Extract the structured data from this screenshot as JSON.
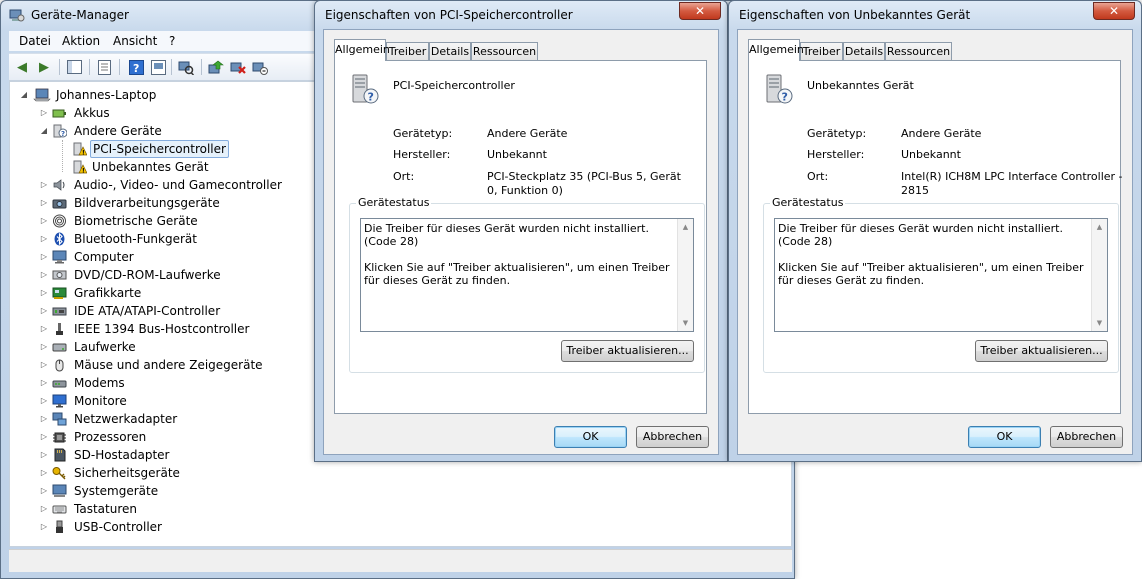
{
  "device_manager": {
    "title": "Geräte-Manager",
    "menu": [
      "Datei",
      "Aktion",
      "Ansicht",
      "?"
    ],
    "toolbar_icons": [
      "back-icon",
      "forward-icon",
      "show-hide-console-tree-icon",
      "properties-page-icon",
      "help-icon",
      "view-hidden-icon",
      "scan-hardware-icon",
      "update-driver-icon",
      "uninstall-icon",
      "disable-icon"
    ],
    "tree": {
      "root": "Johannes-Laptop",
      "items": [
        {
          "label": "Akkus",
          "icon": "battery-icon"
        },
        {
          "label": "Andere Geräte",
          "icon": "unknown-device-icon",
          "expanded": true,
          "children": [
            {
              "label": "PCI-Speichercontroller",
              "icon": "warning-device-icon",
              "selected": true
            },
            {
              "label": "Unbekanntes Gerät",
              "icon": "warning-device-icon"
            }
          ]
        },
        {
          "label": "Audio-, Video- und Gamecontroller",
          "icon": "speaker-icon"
        },
        {
          "label": "Bildverarbeitungsgeräte",
          "icon": "camera-icon"
        },
        {
          "label": "Biometrische Geräte",
          "icon": "fingerprint-icon"
        },
        {
          "label": "Bluetooth-Funkgerät",
          "icon": "bluetooth-icon"
        },
        {
          "label": "Computer",
          "icon": "computer-icon"
        },
        {
          "label": "DVD/CD-ROM-Laufwerke",
          "icon": "disc-drive-icon"
        },
        {
          "label": "Grafikkarte",
          "icon": "display-adapter-icon"
        },
        {
          "label": "IDE ATA/ATAPI-Controller",
          "icon": "ide-controller-icon"
        },
        {
          "label": "IEEE 1394 Bus-Hostcontroller",
          "icon": "firewire-icon"
        },
        {
          "label": "Laufwerke",
          "icon": "hard-drive-icon"
        },
        {
          "label": "Mäuse und andere Zeigegeräte",
          "icon": "mouse-icon"
        },
        {
          "label": "Modems",
          "icon": "modem-icon"
        },
        {
          "label": "Monitore",
          "icon": "monitor-icon"
        },
        {
          "label": "Netzwerkadapter",
          "icon": "network-adapter-icon"
        },
        {
          "label": "Prozessoren",
          "icon": "processor-icon"
        },
        {
          "label": "SD-Hostadapter",
          "icon": "sd-card-icon"
        },
        {
          "label": "Sicherheitsgeräte",
          "icon": "key-icon"
        },
        {
          "label": "Systemgeräte",
          "icon": "system-device-icon"
        },
        {
          "label": "Tastaturen",
          "icon": "keyboard-icon"
        },
        {
          "label": "USB-Controller",
          "icon": "usb-icon"
        }
      ]
    }
  },
  "dialogs": [
    {
      "title": "Eigenschaften von PCI-Speichercontroller",
      "tabs": [
        "Allgemein",
        "Treiber",
        "Details",
        "Ressourcen"
      ],
      "device_name": "PCI-Speichercontroller",
      "device_type_label": "Gerätetyp:",
      "device_type": "Andere Geräte",
      "manufacturer_label": "Hersteller:",
      "manufacturer": "Unbekannt",
      "location_label": "Ort:",
      "location": "PCI-Steckplatz 35 (PCI-Bus 5, Gerät 0, Funktion 0)",
      "status_group": "Gerätestatus",
      "status_line1": "Die Treiber für dieses Gerät wurden nicht installiert. (Code 28)",
      "status_line2": "Klicken Sie auf \"Treiber aktualisieren\", um einen Treiber für dieses Gerät zu finden.",
      "update_button": "Treiber aktualisieren...",
      "ok_button": "OK",
      "cancel_button": "Abbrechen"
    },
    {
      "title": "Eigenschaften von Unbekanntes Gerät",
      "tabs": [
        "Allgemein",
        "Treiber",
        "Details",
        "Ressourcen"
      ],
      "device_name": "Unbekanntes Gerät",
      "device_type_label": "Gerätetyp:",
      "device_type": "Andere Geräte",
      "manufacturer_label": "Hersteller:",
      "manufacturer": "Unbekannt",
      "location_label": "Ort:",
      "location": "Intel(R) ICH8M LPC Interface Controller - 2815",
      "status_group": "Gerätestatus",
      "status_line1": "Die Treiber für dieses Gerät wurden nicht installiert. (Code 28)",
      "status_line2": "Klicken Sie auf \"Treiber aktualisieren\", um einen Treiber für dieses Gerät zu finden.",
      "update_button": "Treiber aktualisieren...",
      "ok_button": "OK",
      "cancel_button": "Abbrechen"
    }
  ]
}
